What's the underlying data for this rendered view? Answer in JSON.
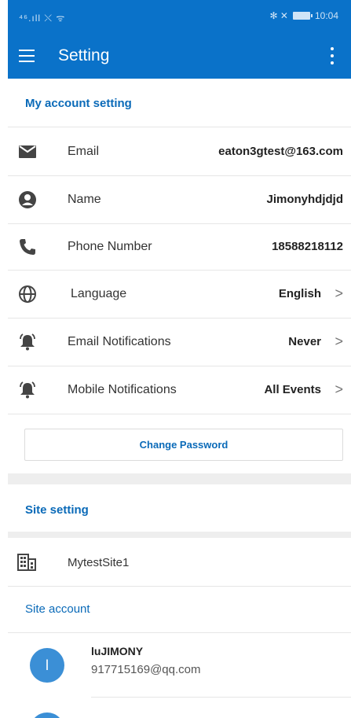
{
  "status_bar": {
    "left_text": "⁴⁶.ıll ⤬ ᯤ",
    "right_icons_text": "✻ ✕",
    "time": "10:04"
  },
  "app_bar": {
    "title": "Setting"
  },
  "my_account": {
    "header": "My account setting",
    "rows": [
      {
        "icon": "mail-icon",
        "label": "Email",
        "value": "eaton3gtest@163.com"
      },
      {
        "icon": "account-circle-icon",
        "label": "Name",
        "value": "Jimonyhdjdjd"
      },
      {
        "icon": "phone-icon",
        "label": "Phone Number",
        "value": "18588218112"
      },
      {
        "icon": "globe-icon",
        "label": "Language",
        "value": "English",
        "chevron": ">"
      },
      {
        "icon": "alarm-bell-icon",
        "label": "Email Notifications",
        "value": "Never",
        "chevron": ">"
      },
      {
        "icon": "alarm-bell-icon",
        "label": "Mobile Notifications",
        "value": "All Events",
        "chevron": ">"
      }
    ],
    "change_password_label": "Change Password"
  },
  "site_setting": {
    "header": "Site setting",
    "site_name": "MytestSite1",
    "site_account_header": "Site account",
    "accounts": [
      {
        "initial": "l",
        "name": "luJIMONY",
        "email": "917715169@qq.com"
      }
    ]
  },
  "colors": {
    "brand_blue": "#0a72c9",
    "accent_text": "#0a6ab8",
    "avatar_blue": "#3b8fd6"
  }
}
